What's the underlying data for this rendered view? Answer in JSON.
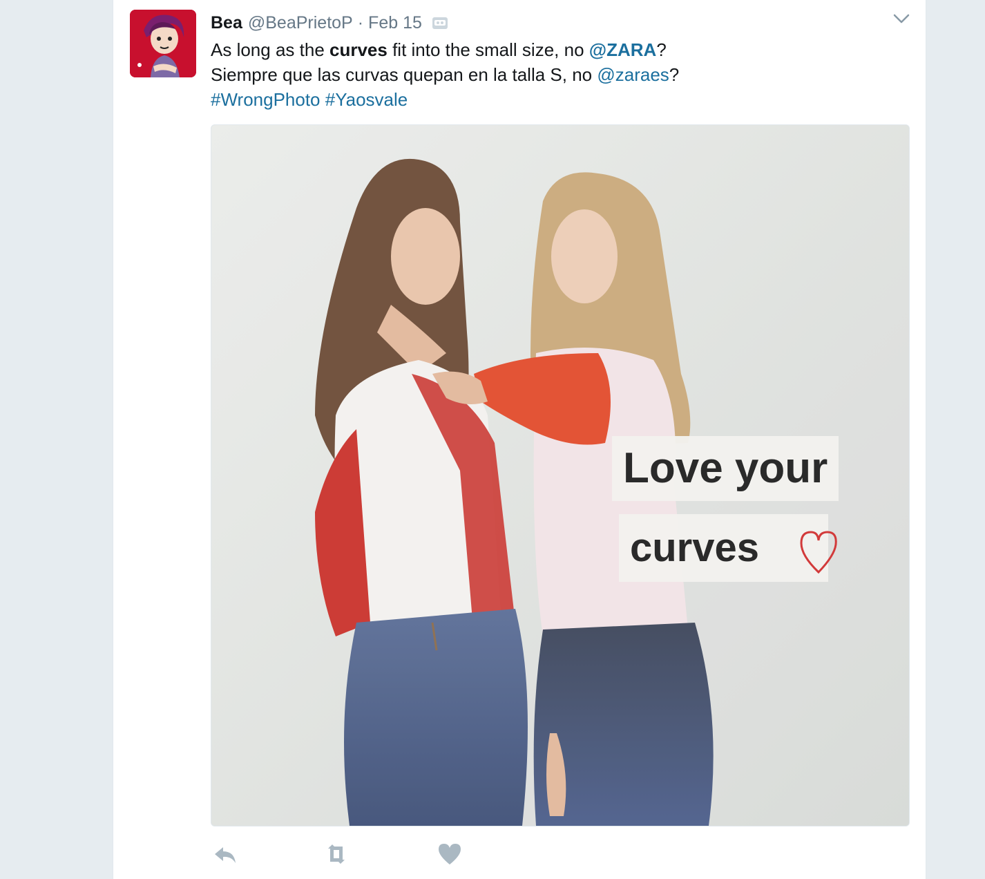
{
  "tweet": {
    "name": "Bea",
    "handle": "@BeaPrietoP",
    "separator": "·",
    "date": "Feb 15",
    "text": {
      "line1_before": "As long as the ",
      "line1_bold": "curves",
      "line1_mid": " fit into the small size, no ",
      "line1_mention": "@ZARA",
      "line1_end": "?",
      "line2_before": "Siempre que las curvas quepan en la talla S, no ",
      "line2_mention": "@zaraes",
      "line2_end": "?",
      "hashtag1": "#WrongPhoto",
      "hashtag2": "#Yaosvale"
    },
    "media": {
      "caption_line1": "Love your",
      "caption_line2": "curves"
    }
  },
  "icons": {
    "avatar": "avatar",
    "robot": "robot-icon",
    "caret": "chevron-down-icon",
    "reply": "reply-icon",
    "retweet": "retweet-icon",
    "like": "heart-icon"
  },
  "colors": {
    "link": "#1b6f9e",
    "secondary": "#657786",
    "text": "#14171a",
    "background": "#e6ecf0"
  }
}
